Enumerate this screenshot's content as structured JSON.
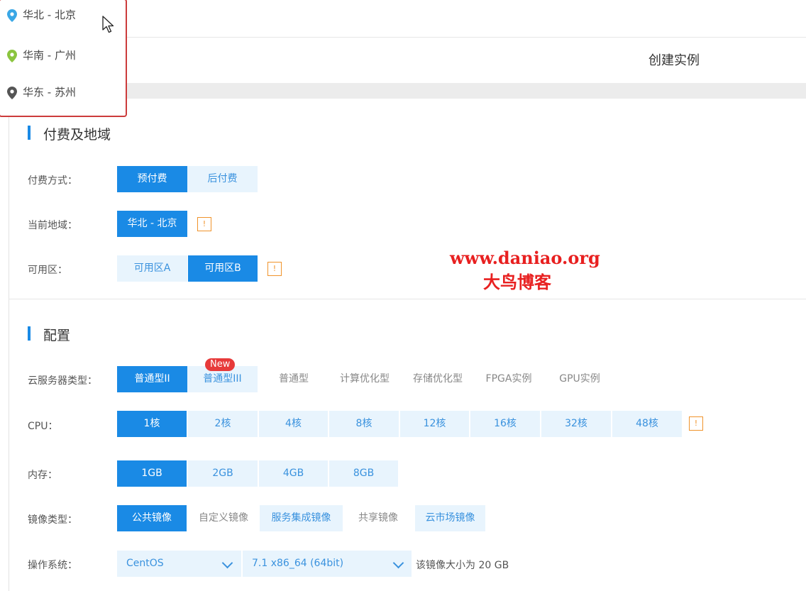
{
  "header": {
    "create_title": "创建实例"
  },
  "region_dropdown": {
    "items": [
      {
        "label": "华北 - 北京",
        "pin_color": "#3aa7e6"
      },
      {
        "label": "华南 - 广州",
        "pin_color": "#8bc53f"
      },
      {
        "label": "华东 - 苏州",
        "pin_color": "#555555"
      }
    ]
  },
  "billing": {
    "section_title": "付费及地域",
    "pay_label": "付费方式：",
    "pay_options": [
      "预付费",
      "后付费"
    ],
    "pay_selected": "预付费",
    "region_label": "当前地域：",
    "region_value": "华北 - 北京",
    "zone_label": "可用区：",
    "zone_options": [
      "可用区A",
      "可用区B"
    ],
    "zone_selected": "可用区B",
    "info_glyph": "!"
  },
  "config": {
    "section_title": "配置",
    "server_type_label": "云服务器类型：",
    "server_types": [
      "普通型II",
      "普通型III",
      "普通型",
      "计算优化型",
      "存储优化型",
      "FPGA实例",
      "GPU实例"
    ],
    "server_type_selected": "普通型II",
    "new_badge": "New",
    "cpu_label": "CPU：",
    "cpu_options": [
      "1核",
      "2核",
      "4核",
      "8核",
      "12核",
      "16核",
      "32核",
      "48核"
    ],
    "cpu_selected": "1核",
    "mem_label": "内存：",
    "mem_options": [
      "1GB",
      "2GB",
      "4GB",
      "8GB"
    ],
    "mem_selected": "1GB",
    "image_label": "镜像类型：",
    "image_options": [
      "公共镜像",
      "自定义镜像",
      "服务集成镜像",
      "共享镜像",
      "云市场镜像"
    ],
    "image_selected": "公共镜像",
    "os_label": "操作系统：",
    "os_value": "CentOS",
    "version_value": "7.1 x86_64 (64bit)",
    "size_note": "该镜像大小为 20 GB"
  },
  "watermark": {
    "url": "www.daniao.org",
    "name": "大鸟博客"
  },
  "colors": {
    "accent": "#1a8ae5",
    "light": "#e8f4fd",
    "warning": "#f0932b",
    "badge": "#e73a3a"
  }
}
